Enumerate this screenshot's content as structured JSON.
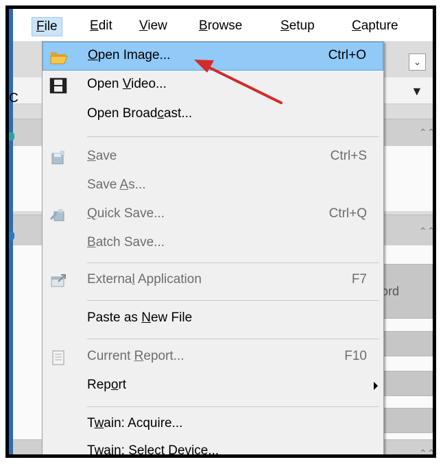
{
  "menubar": {
    "items": [
      {
        "pre": "",
        "u": "F",
        "post": "ile"
      },
      {
        "pre": "",
        "u": "E",
        "post": "dit"
      },
      {
        "pre": "",
        "u": "V",
        "post": "iew"
      },
      {
        "pre": "",
        "u": "B",
        "post": "rowse"
      },
      {
        "pre": "",
        "u": "S",
        "post": "etup"
      },
      {
        "pre": "",
        "u": "C",
        "post": "apture"
      }
    ]
  },
  "background": {
    "left_letter": "C",
    "partial_text": "ord",
    "dropdown_glyph": "⌄",
    "caret": "▼",
    "collapse": "⌃⌃"
  },
  "file_menu": {
    "items": [
      {
        "pre": "",
        "u": "O",
        "post": "pen Image...",
        "shortcut": "Ctrl+O",
        "icon": "folder-open-icon"
      },
      {
        "pre": "Open ",
        "u": "V",
        "post": "ideo...",
        "shortcut": "",
        "icon": "film-icon"
      },
      {
        "pre": "Open Broad",
        "u": "c",
        "post": "ast...",
        "shortcut": "",
        "icon": ""
      },
      {
        "pre": "",
        "u": "S",
        "post": "ave",
        "shortcut": "Ctrl+S",
        "icon": "save-icon"
      },
      {
        "pre": "Save ",
        "u": "A",
        "post": "s...",
        "shortcut": "",
        "icon": ""
      },
      {
        "pre": "",
        "u": "Q",
        "post": "uick Save...",
        "shortcut": "Ctrl+Q",
        "icon": "quick-save-icon"
      },
      {
        "pre": "",
        "u": "B",
        "post": "atch Save...",
        "shortcut": "",
        "icon": ""
      },
      {
        "pre": "Externa",
        "u": "l",
        "post": " Application",
        "shortcut": "F7",
        "icon": "external-app-icon"
      },
      {
        "pre": "Paste as ",
        "u": "N",
        "post": "ew File",
        "shortcut": "",
        "icon": ""
      },
      {
        "pre": "Current ",
        "u": "R",
        "post": "eport...",
        "shortcut": "F10",
        "icon": "report-icon"
      },
      {
        "pre": "Rep",
        "u": "o",
        "post": "rt",
        "shortcut": "",
        "icon": ""
      },
      {
        "pre": "T",
        "u": "w",
        "post": "ain: Acquire...",
        "shortcut": "",
        "icon": ""
      },
      {
        "pre": "",
        "u": "T",
        "post": "wain: Select Device...",
        "shortcut": "",
        "icon": ""
      }
    ]
  }
}
